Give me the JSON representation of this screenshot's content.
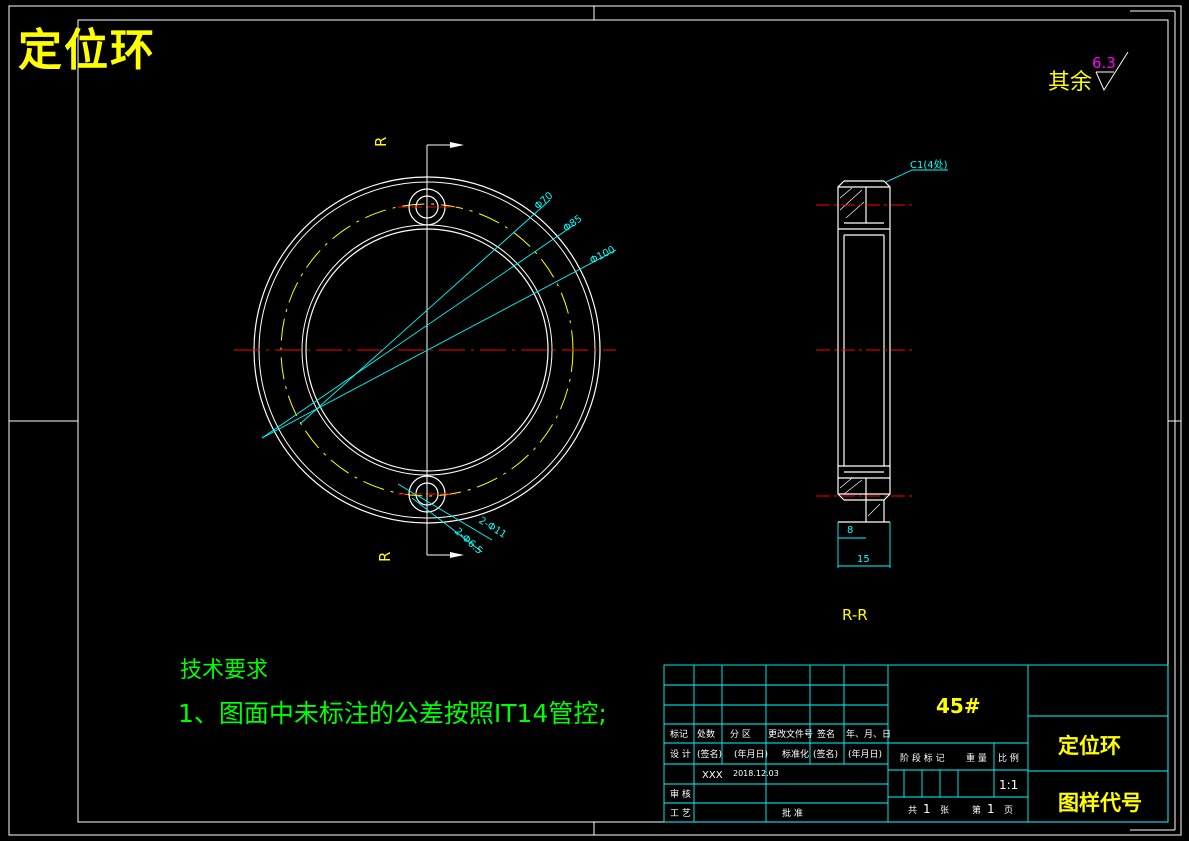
{
  "header": {
    "part_title": "定位环"
  },
  "roughness": {
    "label": "其余",
    "value": "6.3"
  },
  "front_view": {
    "section_mark_top": "R",
    "section_mark_bottom": "R",
    "dims": {
      "d70": "Φ70",
      "d85": "Φ85",
      "d100": "Φ100",
      "holes_large": "2-Φ11",
      "holes_small": "2-Φ6.5"
    }
  },
  "side_view": {
    "chamfer": "C1(4处)",
    "dim_8": "8",
    "dim_15": "15",
    "section_label": "R-R"
  },
  "tech_requirements": {
    "title": "技术要求",
    "items": [
      "1、图面中未标注的公差按照IT14管控;"
    ]
  },
  "title_block": {
    "material": "45#",
    "part_name": "定位环",
    "drawing_number_label": "图样代号",
    "row_labels_1": [
      "标记",
      "处数",
      "分 区",
      "更改文件号",
      "签名",
      "年、月、日"
    ],
    "row_labels_2": [
      "设 计",
      "(签名)",
      "(年月日)",
      "标准化",
      "(签名)",
      "(年月日)"
    ],
    "designer": "XXX",
    "date": "2018.12.03",
    "review_label": "审 核",
    "process_label": "工 艺",
    "approve_label": "批 准",
    "stage_labels": [
      "阶 段 标 记",
      "重 量",
      "比 例"
    ],
    "scale": "1:1",
    "sheets": {
      "total_label": "共",
      "total": "1",
      "sheet_unit": "张",
      "page_label": "第",
      "page": "1",
      "page_unit": "页"
    }
  },
  "colors": {
    "background": "#000000",
    "outline": "#ffffff",
    "dimension": "#00ffff",
    "centerline": "#ff0000",
    "hidden": "#ffff00",
    "text_yellow": "#ffff00",
    "text_green": "#00ff00",
    "magenta": "#ff00ff"
  }
}
